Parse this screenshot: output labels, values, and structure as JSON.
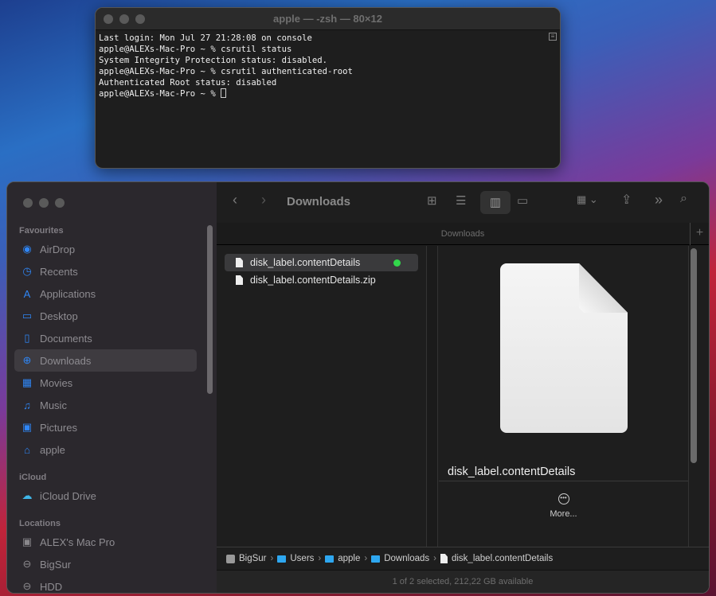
{
  "terminal": {
    "title": "apple — -zsh — 80×12",
    "lines": [
      "Last login: Mon Jul 27 21:28:08 on console",
      "apple@ALEXs-Mac-Pro ~ % csrutil status",
      "System Integrity Protection status: disabled.",
      "apple@ALEXs-Mac-Pro ~ % csrutil authenticated-root",
      "Authenticated Root status: disabled",
      "apple@ALEXs-Mac-Pro ~ % "
    ]
  },
  "finder": {
    "title": "Downloads",
    "tab": "Downloads",
    "sidebar": {
      "favourites_label": "Favourites",
      "favourites": [
        {
          "label": "AirDrop",
          "icon": "airdrop-icon"
        },
        {
          "label": "Recents",
          "icon": "clock-icon"
        },
        {
          "label": "Applications",
          "icon": "applications-icon"
        },
        {
          "label": "Desktop",
          "icon": "desktop-icon"
        },
        {
          "label": "Documents",
          "icon": "document-icon"
        },
        {
          "label": "Downloads",
          "icon": "download-icon"
        },
        {
          "label": "Movies",
          "icon": "film-icon"
        },
        {
          "label": "Music",
          "icon": "music-icon"
        },
        {
          "label": "Pictures",
          "icon": "pictures-icon"
        },
        {
          "label": "apple",
          "icon": "home-icon"
        }
      ],
      "icloud_label": "iCloud",
      "icloud": [
        {
          "label": "iCloud Drive",
          "icon": "cloud-icon"
        }
      ],
      "locations_label": "Locations",
      "locations": [
        {
          "label": "ALEX's Mac Pro",
          "icon": "computer-icon"
        },
        {
          "label": "BigSur",
          "icon": "disk-icon"
        },
        {
          "label": "HDD",
          "icon": "disk-icon"
        }
      ]
    },
    "files": [
      {
        "name": "disk_label.contentDetails",
        "selected": true,
        "tag_color": "#32d74b"
      },
      {
        "name": "disk_label.contentDetails.zip",
        "selected": false
      }
    ],
    "preview": {
      "name": "disk_label.contentDetails",
      "more_label": "More..."
    },
    "path": [
      "BigSur",
      "Users",
      "apple",
      "Downloads",
      "disk_label.contentDetails"
    ],
    "status": "1 of 2 selected, 212,22 GB available"
  }
}
